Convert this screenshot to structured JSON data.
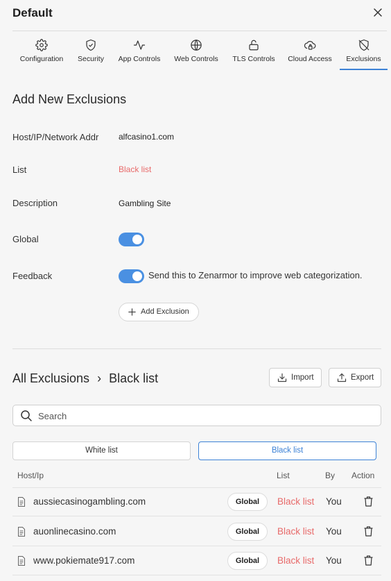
{
  "header": {
    "title": "Default"
  },
  "tabs": [
    {
      "label": "Configuration",
      "icon": "gear-icon"
    },
    {
      "label": "Security",
      "icon": "shield-check-icon"
    },
    {
      "label": "App Controls",
      "icon": "activity-icon"
    },
    {
      "label": "Web Controls",
      "icon": "globe-icon"
    },
    {
      "label": "TLS Controls",
      "icon": "unlock-icon"
    },
    {
      "label": "Cloud Access",
      "icon": "cloud-lock-icon"
    },
    {
      "label": "Exclusions",
      "icon": "shield-off-icon",
      "active": true
    }
  ],
  "form": {
    "title": "Add New Exclusions",
    "host_label": "Host/IP/Network Addr",
    "host_value": "alfcasino1.com",
    "list_label": "List",
    "list_value": "Black list",
    "description_label": "Description",
    "description_value": "Gambling Site",
    "global_label": "Global",
    "global_on": true,
    "feedback_label": "Feedback",
    "feedback_on": true,
    "feedback_text": "Send this to Zenarmor to improve web categorization.",
    "add_button": "Add Exclusion"
  },
  "exclusions": {
    "title": "All Exclusions",
    "separator": "›",
    "current_list": "Black list",
    "import_label": "Import",
    "export_label": "Export",
    "search_placeholder": "Search",
    "segments": {
      "white": "White list",
      "black": "Black list",
      "active": "black"
    },
    "columns": {
      "host": "Host/Ip",
      "list": "List",
      "by": "By",
      "action": "Action"
    },
    "rows": [
      {
        "host": "aussiecasinogambling.com",
        "badge": "Global",
        "list": "Black list",
        "by": "You"
      },
      {
        "host": "auonlinecasino.com",
        "badge": "Global",
        "list": "Black list",
        "by": "You"
      },
      {
        "host": "www.pokiemate917.com",
        "badge": "Global",
        "list": "Black list",
        "by": "You"
      }
    ]
  },
  "colors": {
    "accent": "#3d82d6",
    "toggle": "#4a90e2",
    "danger_text": "#e86a6a",
    "background": "#f6f6f6"
  }
}
